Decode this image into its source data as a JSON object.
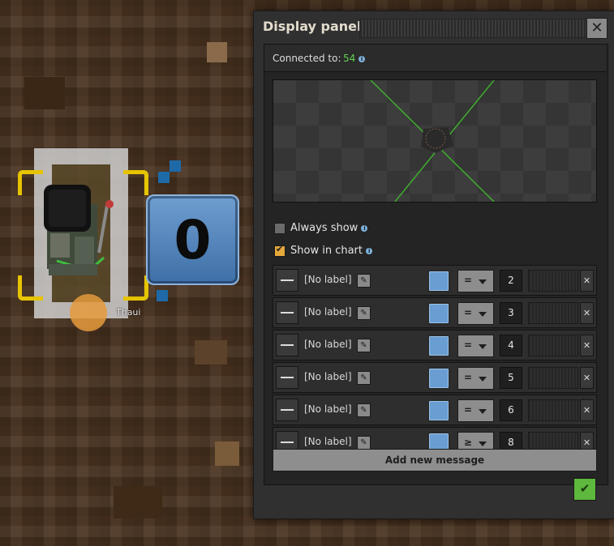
{
  "world": {
    "display_value": "0",
    "player_name": "Thaui"
  },
  "panel": {
    "title": "Display panel",
    "close_icon": "close-icon",
    "connected_label": "Connected to:",
    "connected_id": "54",
    "always_show": {
      "label": "Always show",
      "checked": false
    },
    "show_in_chart": {
      "label": "Show in chart",
      "checked": true
    },
    "messages": [
      {
        "label": "[No label]",
        "comparator": "=",
        "value": "2"
      },
      {
        "label": "[No label]",
        "comparator": "=",
        "value": "3"
      },
      {
        "label": "[No label]",
        "comparator": "=",
        "value": "4"
      },
      {
        "label": "[No label]",
        "comparator": "=",
        "value": "5"
      },
      {
        "label": "[No label]",
        "comparator": "=",
        "value": "6"
      },
      {
        "label": "[No label]",
        "comparator": "≥",
        "value": "8"
      }
    ],
    "add_message_label": "Add new message",
    "confirm_icon": "checkmark-icon"
  },
  "colors": {
    "connected_id": "#5fd34e",
    "selection": "#e6c400",
    "display_box": "#4f84bc",
    "confirm": "#5eb83e",
    "checkbox_checked": "#e6a83a"
  }
}
